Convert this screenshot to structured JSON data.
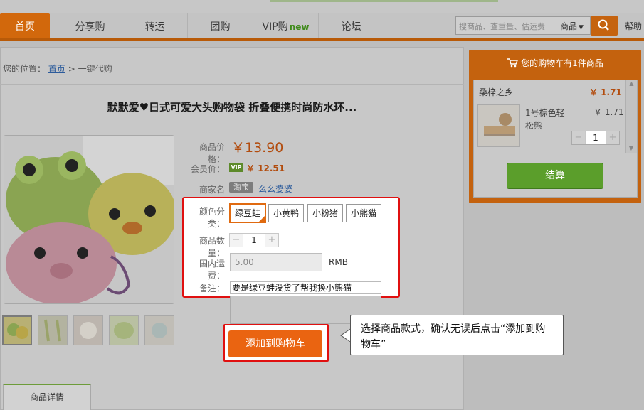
{
  "nav": {
    "items": [
      "首页",
      "分享购",
      "转运",
      "团购",
      "VIP购",
      "论坛"
    ],
    "vip_new": "new",
    "search_placeholder": "搜商品、查重量、估运费",
    "search_category": "商品",
    "help": "帮助"
  },
  "breadcrumb": {
    "prefix": "您的位置：",
    "home": "首页",
    "sep": ">",
    "current": "一键代购"
  },
  "product": {
    "title": "默默爱♥日式可爱大头购物袋 折叠便携时尚防水环...",
    "price_label": "商品价格：",
    "price": "￥13.90",
    "member_label": "会员价：",
    "vip_badge": "VIP",
    "member_price": "￥ 12.51",
    "merchant_label": "商家名称：",
    "merchant_platform": "淘宝",
    "merchant_name": "么么婆婆",
    "color_label": "颜色分类：",
    "colors": [
      "绿豆蛙",
      "小黄鸭",
      "小粉猪",
      "小熊猫"
    ],
    "selected_color_index": 0,
    "qty_label": "商品数量：",
    "qty": "1",
    "shipping_label": "国内运费：",
    "shipping_value": "5.00",
    "currency": "RMB",
    "note_label": "备注：",
    "note_value": "要是绿豆蛙没货了帮我换小熊猫",
    "add_to_cart": "添加到购物车",
    "details_tab": "商品详情"
  },
  "callout": {
    "text": "选择商品款式，确认无误后点击“添加到购物车”"
  },
  "cart": {
    "header": "您的购物车有1件商品",
    "shop_name": "桑梓之乡",
    "shop_total": "￥ 1.71",
    "item_name": "1号棕色轻松熊",
    "item_price": "￥ 1.71",
    "item_qty": "1",
    "checkout": "结算"
  },
  "colors": {
    "accent_orange": "#ea6411",
    "highlight_red": "#e01010",
    "checkout_green": "#5b9e2b"
  }
}
